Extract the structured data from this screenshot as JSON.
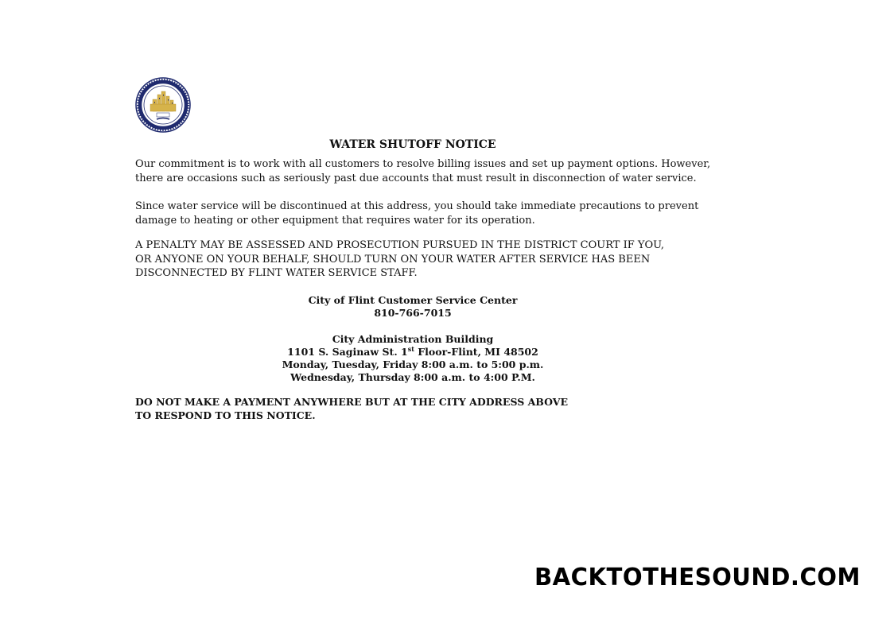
{
  "document": {
    "title": "WATER SHUTOFF NOTICE",
    "paragraphs": {
      "commitment": [
        "Our commitment is to work with all customers to resolve billing issues and set up payment options. However,",
        "there are occasions such as seriously past due accounts that must result in disconnection of water service."
      ],
      "precautions": [
        "Since water service will be discontinued at this address, you should take immediate precautions to prevent",
        "damage to heating or other equipment that requires water for its operation."
      ],
      "penalty": [
        "A PENALTY MAY BE ASSESSED AND PROSECUTION PURSUED IN THE DISTRICT COURT IF YOU,",
        "OR ANYONE ON YOUR BEHALF, SHOULD TURN ON YOUR WATER AFTER SERVICE HAS BEEN",
        "DISCONNECTED BY FLINT WATER SERVICE STAFF."
      ]
    },
    "customer_service": {
      "name": "City of Flint Customer Service Center",
      "phone": "810-766-7015"
    },
    "administration": {
      "building": "City Administration Building",
      "address_pre": "1101 S. Saginaw St. 1",
      "address_sup": "st",
      "address_post": " Floor-Flint, MI 48502",
      "hours_1": "Monday, Tuesday, Friday 8:00 a.m. to 5:00 p.m.",
      "hours_2": "Wednesday, Thursday 8:00 a.m. to 4:00 P.M."
    },
    "warning": [
      "DO NOT MAKE A PAYMENT ANYWHERE BUT AT THE CITY ADDRESS ABOVE",
      "TO RESPOND TO THIS NOTICE."
    ]
  },
  "seal": {
    "text": "CITY OF FLINT, MICHIGAN",
    "year": "1855",
    "colors": {
      "ring": "#1f2a6e",
      "gold": "#d6b34a"
    }
  },
  "watermark": {
    "text": "BACKTOTHESOUND.COM"
  }
}
